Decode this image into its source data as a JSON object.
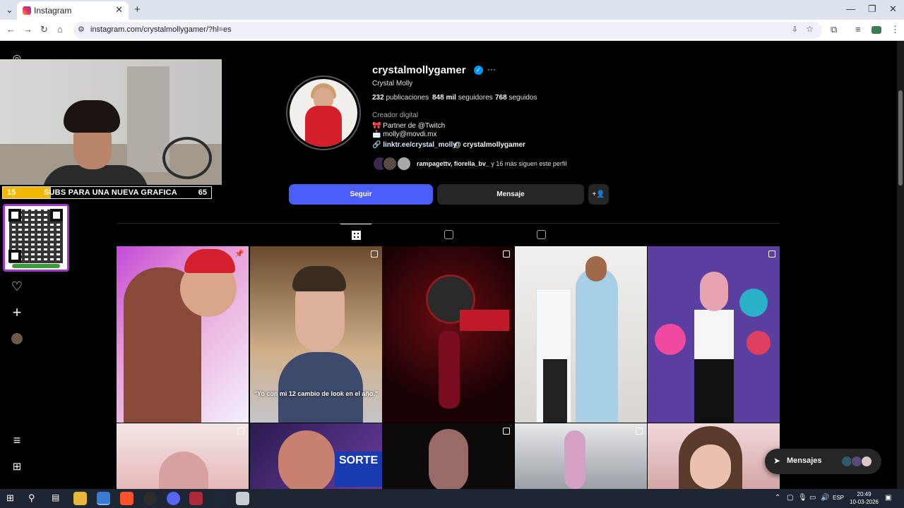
{
  "browser": {
    "tab_title": "Instagram",
    "url": "instagram.com/crystalmollygamer/?hl=es"
  },
  "stream_overlay": {
    "goal_current": "15",
    "goal_text": "SUBS PARA UNA NUEVA GRAFICA",
    "goal_target": "65",
    "goal_progress": 0.23
  },
  "profile": {
    "username": "crystalmollygamer",
    "full_name": "Crystal Molly",
    "posts_count": "232",
    "posts_label": "publicaciones",
    "followers_count": "848 mil",
    "followers_label": "seguidores",
    "following_count": "768",
    "following_label": "seguidos",
    "category": "Creador digital",
    "bio_line1": "🎀 Partner de @Twitch",
    "bio_line2": "📩 molly@movdi.mx",
    "link": "linktr.ee/crystal_molly",
    "threads_handle": "crystalmollygamer",
    "mutual_names": "rampagettv, fiorella_bv_",
    "mutual_rest": " y 16 más siguen este perfil",
    "follow_label": "Seguir",
    "message_label": "Mensaje",
    "verified_color": "#0095f6"
  },
  "posts": [
    {
      "caption": "",
      "badge": "pin-icon"
    },
    {
      "caption": "",
      "badge": "reel-icon"
    },
    {
      "caption": "",
      "badge": "carousel-icon"
    },
    {
      "caption": "",
      "badge": ""
    },
    {
      "caption": "",
      "badge": "carousel-icon"
    },
    {
      "caption": "",
      "badge": "carousel-icon"
    },
    {
      "caption": "",
      "badge": ""
    },
    {
      "caption": "",
      "badge": "carousel-icon"
    },
    {
      "caption": "",
      "badge": "carousel-icon"
    },
    {
      "caption": "",
      "badge": ""
    }
  ],
  "post2_caption": "\"Yo con mi 12 cambio de look en el año.\"",
  "post7_text": "SORTE",
  "messages": {
    "label": "Mensajes"
  },
  "taskbar": {
    "language": "ESP",
    "time": "20:49",
    "date": "10-03-2026"
  },
  "colors": {
    "accent": "#4a5df9",
    "background": "#000000"
  }
}
